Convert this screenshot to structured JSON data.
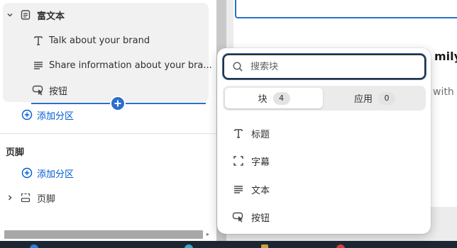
{
  "sidebar": {
    "rich_text_section": {
      "title": "富文本",
      "blocks": [
        {
          "label": "Talk about your brand",
          "icon": "text-heading-icon"
        },
        {
          "label": "Share information about your bra...",
          "icon": "paragraph-icon"
        },
        {
          "label": "按钮",
          "icon": "button-cursor-icon"
        }
      ],
      "add_section_label": "添加分区"
    },
    "footer_group": {
      "heading": "页脚",
      "add_section_label": "添加分区",
      "footer_item_label": "页脚"
    }
  },
  "preview": {
    "heading_fragment": "mily",
    "body_fragment": "with s"
  },
  "popover": {
    "search_placeholder": "搜索块",
    "tabs": [
      {
        "label": "块",
        "count": "4"
      },
      {
        "label": "应用",
        "count": "0"
      }
    ],
    "items": [
      {
        "label": "标题",
        "icon": "text-heading-icon"
      },
      {
        "label": "字幕",
        "icon": "caption-frame-icon"
      },
      {
        "label": "文本",
        "icon": "paragraph-icon"
      },
      {
        "label": "按钮",
        "icon": "button-cursor-icon"
      }
    ]
  },
  "colors": {
    "accent": "#2c6ecb",
    "link": "#005bd3",
    "text": "#303030"
  }
}
